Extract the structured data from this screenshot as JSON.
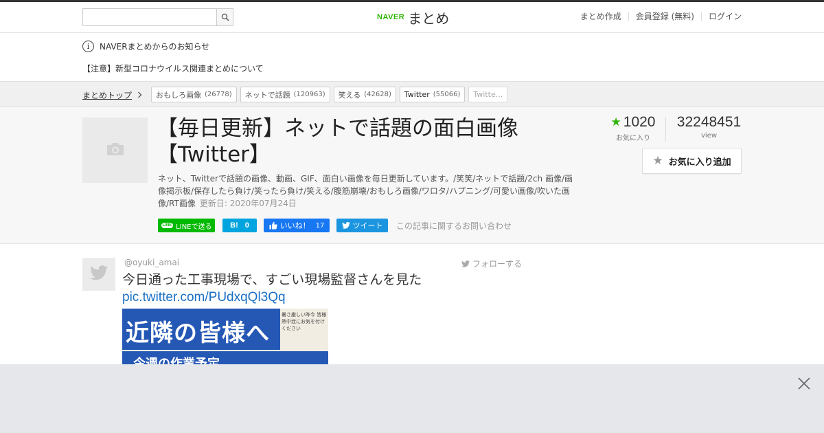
{
  "header": {
    "search": {
      "placeholder": "",
      "value": ""
    },
    "logo": {
      "brand": "NAVER",
      "service": "まとめ"
    },
    "nav": [
      "まとめ作成",
      "会員登録 (無料)",
      "ログイン"
    ]
  },
  "notice": {
    "heading": "NAVERまとめからのお知らせ",
    "link": "【注意】新型コロナウイルス関連まとめについて"
  },
  "breadcrumb": {
    "home": "まとめトップ",
    "tags": [
      {
        "label": "おもしろ画像",
        "count": "(26778)"
      },
      {
        "label": "ネットで話題",
        "count": "(120963)"
      },
      {
        "label": "笑える",
        "count": "(42628)"
      },
      {
        "label": "Twitter",
        "count": "(55066)"
      },
      {
        "label": "Twitte...",
        "count": ""
      }
    ]
  },
  "article": {
    "title_line1": "【毎日更新】ネットで話題の面白画像",
    "title_line2": "【Twitter】",
    "description": "ネット、Twitterで話題の画像、動画、GIF、面白い画像を毎日更新しています。/笑笑/ネットで話題/2ch 画像/画像掲示板/保存したら負け/笑ったら負け/笑える/腹筋崩壊/おもしろ画像/ワロタ/ハプニング/可愛い画像/吹いた画像/RT画像",
    "updated": "更新日: 2020年07月24日",
    "favorites": {
      "value": "1020",
      "label": "お気に入り"
    },
    "views": {
      "value": "32248451",
      "label": "view"
    },
    "fav_button": "お気に入り追加"
  },
  "share": {
    "line_icon": "LINE",
    "line": "LINEで送る",
    "hatena": "B!",
    "hatena_count": "0",
    "facebook": "いいね！",
    "facebook_count": "17",
    "twitter": "ツイート",
    "contact": "この記事に関するお問い合わせ"
  },
  "tweet": {
    "handle": "@oyuki_amai",
    "follow": "フォローする",
    "text": "今日通った工事現場で、すごい現場監督さんを見た",
    "link": "pic.twitter.com/PUdxqQl3Qq",
    "image_heading": "近隣の皆様へ",
    "image_subheading": "今週の作業予定",
    "image_note": "暑さ厳しい昨今 皆様 熱中症にお気を付けください"
  },
  "colors": {
    "naver_green": "#2db400",
    "line_green": "#00b900",
    "hatena_blue": "#00a4de",
    "facebook_blue": "#1877f2",
    "twitter_blue": "#1b95e0",
    "link_blue": "#1a6fc4",
    "ad_background": "#e5e7ea"
  },
  "icons": [
    "search-icon",
    "info-icon",
    "chevron-right-icon",
    "camera-icon",
    "star-icon",
    "line-icon",
    "facebook-thumb-icon",
    "twitter-bird-icon",
    "close-icon"
  ]
}
